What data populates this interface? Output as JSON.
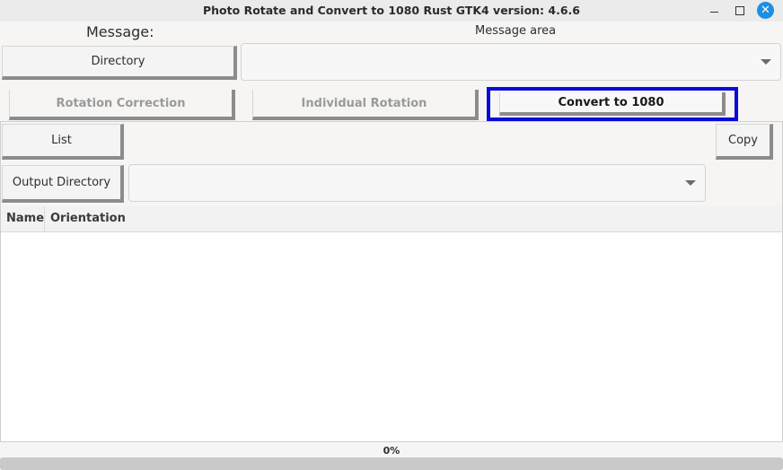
{
  "window": {
    "title": "Photo Rotate and Convert to 1080 Rust GTK4 version: 4.6.6"
  },
  "header": {
    "message_label": "Message:",
    "message_area": "Message area",
    "directory_button": "Directory",
    "directory_value": ""
  },
  "tabs": [
    {
      "label": "Rotation Correction",
      "active": false
    },
    {
      "label": "Individual Rotation",
      "active": false
    },
    {
      "label": "Convert to 1080",
      "active": true
    }
  ],
  "panel": {
    "list_button": "List",
    "copy_button": "Copy",
    "output_directory_button": "Output Directory",
    "output_directory_value": "",
    "table": {
      "columns": [
        "Name",
        "Orientation"
      ],
      "rows": []
    }
  },
  "progress": {
    "text": "0%",
    "value": 0
  },
  "colors": {
    "active_tab_outline": "#0a0ad8",
    "close_button": "#1c8fe3"
  },
  "icons": [
    "minimize-icon",
    "maximize-icon",
    "close-icon",
    "chevron-down-icon"
  ]
}
